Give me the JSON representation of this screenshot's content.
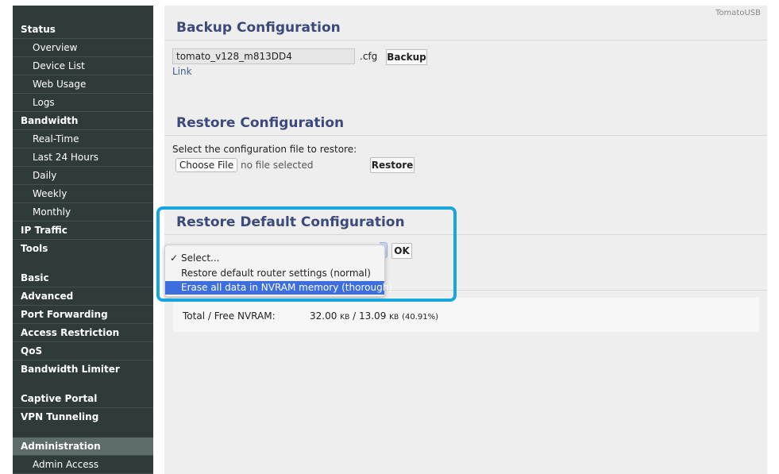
{
  "sidebar": {
    "items": [
      {
        "label": "Status",
        "type": "section"
      },
      {
        "label": "Overview",
        "type": "sub"
      },
      {
        "label": "Device List",
        "type": "sub"
      },
      {
        "label": "Web Usage",
        "type": "sub"
      },
      {
        "label": "Logs",
        "type": "sub"
      },
      {
        "label": "Bandwidth",
        "type": "section"
      },
      {
        "label": "Real-Time",
        "type": "sub"
      },
      {
        "label": "Last 24 Hours",
        "type": "sub"
      },
      {
        "label": "Daily",
        "type": "sub"
      },
      {
        "label": "Weekly",
        "type": "sub"
      },
      {
        "label": "Monthly",
        "type": "sub"
      },
      {
        "label": "IP Traffic",
        "type": "section"
      },
      {
        "label": "Tools",
        "type": "section"
      },
      {
        "label": "Basic",
        "type": "section"
      },
      {
        "label": "Advanced",
        "type": "section"
      },
      {
        "label": "Port Forwarding",
        "type": "section"
      },
      {
        "label": "Access Restriction",
        "type": "section"
      },
      {
        "label": "QoS",
        "type": "section"
      },
      {
        "label": "Bandwidth Limiter",
        "type": "section"
      },
      {
        "label": "Captive Portal",
        "type": "section"
      },
      {
        "label": "VPN Tunneling",
        "type": "section"
      },
      {
        "label": "Administration",
        "type": "section",
        "active": true
      },
      {
        "label": "Admin Access",
        "type": "sub"
      }
    ]
  },
  "brand": "TomatoUSB",
  "backup": {
    "title": "Backup Configuration",
    "filename_value": "tomato_v128_m813DD4",
    "extension": ".cfg",
    "backup_button": "Backup",
    "link_label": "Link"
  },
  "restore": {
    "title": "Restore Configuration",
    "instruction": "Select the configuration file to restore:",
    "choose_file_button": "Choose File",
    "no_file_text": "no file selected",
    "restore_button": "Restore"
  },
  "restore_default": {
    "title": "Restore Default Configuration",
    "ok_button": "OK",
    "options": [
      {
        "label": "Select...",
        "checked": true,
        "highlighted": false
      },
      {
        "label": "Restore default router settings (normal)",
        "checked": false,
        "highlighted": false
      },
      {
        "label": "Erase all data in NVRAM memory (thorough)",
        "checked": false,
        "highlighted": true
      }
    ],
    "check_glyph": "✓"
  },
  "nvram": {
    "label": "Total / Free NVRAM:",
    "total": "32.00",
    "total_unit": "KB",
    "separator": "/",
    "free": "13.09",
    "free_unit": "KB",
    "percent": "(40.91%)"
  },
  "colors": {
    "sidebar_bg": "#2f3a3a",
    "title_color": "#3b4a7a",
    "highlight_border": "#17a6e0",
    "option_highlight": "#3d6ee0"
  }
}
